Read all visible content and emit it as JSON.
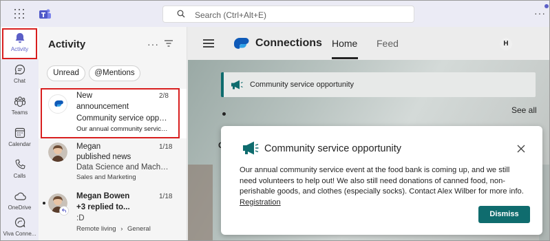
{
  "topbar": {
    "search_placeholder": "Search (Ctrl+Alt+E)",
    "more_label": "···"
  },
  "rail": {
    "items": [
      {
        "label": "Activity",
        "icon": "bell-icon"
      },
      {
        "label": "Chat",
        "icon": "chat-icon"
      },
      {
        "label": "Teams",
        "icon": "teams-icon"
      },
      {
        "label": "Calendar",
        "icon": "calendar-icon"
      },
      {
        "label": "Calls",
        "icon": "phone-icon"
      },
      {
        "label": "OneDrive",
        "icon": "cloud-icon"
      },
      {
        "label": "Viva Conne...",
        "icon": "viva-connections-icon"
      }
    ]
  },
  "activity": {
    "title": "Activity",
    "more_label": "···",
    "filters": [
      "Unread",
      "@Mentions"
    ],
    "items": [
      {
        "title1": "New",
        "title2": "announcement",
        "count": "2/8",
        "subtitle": "Community service oppor...",
        "preview": "Our annual community service..."
      },
      {
        "title1": "Megan",
        "title2": "published news",
        "count": "1/18",
        "subtitle": "Data Science and Machin...",
        "preview": "Sales and Marketing"
      },
      {
        "title1": "Megan Bowen",
        "title2": "+3 replied to...",
        "count": "1/18",
        "subtitle": ":D",
        "preview_a": "Remote living",
        "preview_sep": "›",
        "preview_b": "General"
      }
    ]
  },
  "app": {
    "title": "Connections",
    "tabs": [
      "Home",
      "Feed"
    ],
    "user_initial": "H",
    "banner_text": "Community service opportunity",
    "see_all": "See all",
    "section_letter": "C"
  },
  "popup": {
    "title": "Community service opportunity",
    "body": "Our annual community service event at the food bank is coming up, and we still need volunteers to help out! We also still need donations of canned food, non-perishable goods, and clothes (especially socks). Contact Alex Wilber for more info.",
    "link": "Registration",
    "dismiss": "Dismiss"
  },
  "colors": {
    "teams_purple": "#5b5fc7",
    "teal": "#0f6c6e",
    "highlight_red": "#d81e1e"
  }
}
